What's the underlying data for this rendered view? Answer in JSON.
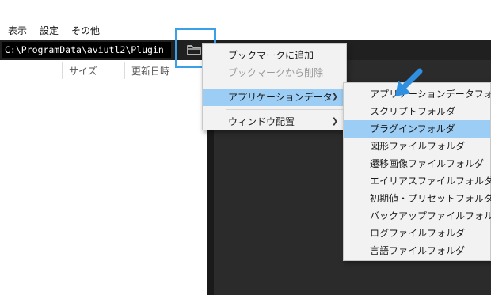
{
  "menubar": {
    "items": [
      "表示",
      "設定",
      "その他"
    ]
  },
  "path": {
    "value": "C:\\ProgramData\\aviutl2\\Plugin"
  },
  "columns": {
    "size": "サイズ",
    "modified": "更新日時"
  },
  "context_menu": {
    "bookmark_add": "ブックマークに追加",
    "bookmark_remove": "ブックマークから削除",
    "app_data": "アプリケーションデータ",
    "window_layout": "ウィンドウ配置"
  },
  "submenu": {
    "items": [
      "アプリケーションデータフォルダ",
      "スクリプトフォルダ",
      "プラグインフォルダ",
      "図形ファイルフォルダ",
      "遷移画像ファイルフォルダ",
      "エイリアスファイルフォルダ",
      "初期値・プリセットフォルダ",
      "バックアップファイルフォルダ",
      "ログファイルフォルダ",
      "言語ファイルフォルダ"
    ]
  },
  "colors": {
    "highlight": "#3aa0e8",
    "selection": "#9ccdf5"
  },
  "icons": {
    "folder": "folder-icon",
    "pointer": "arrow-pointer-icon"
  }
}
